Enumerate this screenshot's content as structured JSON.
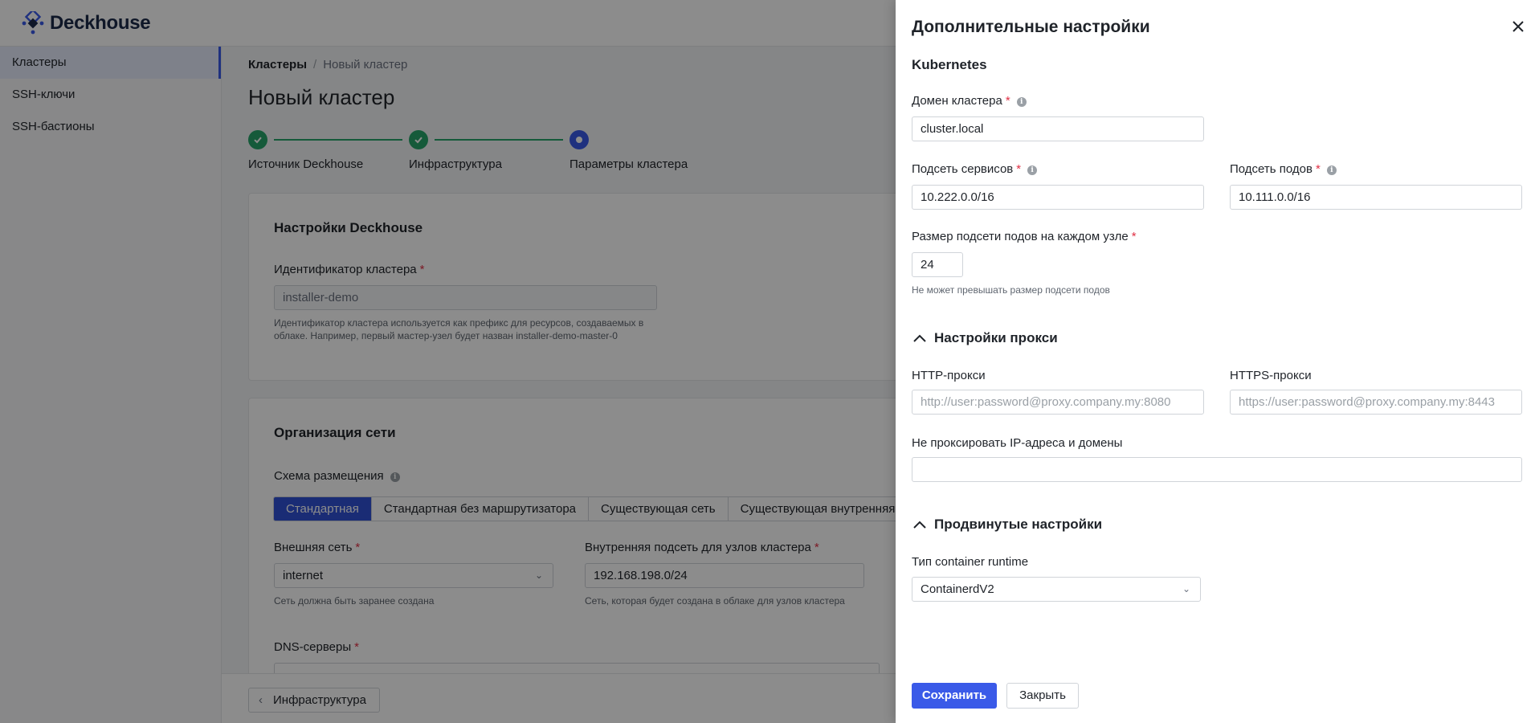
{
  "app": {
    "logo_text": "Deckhouse"
  },
  "sidebar": {
    "items": [
      {
        "label": "Кластеры",
        "active": true
      },
      {
        "label": "SSH-ключи",
        "active": false
      },
      {
        "label": "SSH-бастионы",
        "active": false
      }
    ]
  },
  "breadcrumb": {
    "root": "Кластеры",
    "separator": "/",
    "current": "Новый кластер"
  },
  "page": {
    "title": "Новый кластер"
  },
  "stepper": {
    "steps": [
      {
        "label": "Источник Deckhouse",
        "state": "done"
      },
      {
        "label": "Инфраструктура",
        "state": "done"
      },
      {
        "label": "Параметры кластера",
        "state": "current"
      }
    ]
  },
  "deckhouse_card": {
    "title": "Настройки Deckhouse",
    "cluster_id_label": "Идентификатор кластера",
    "cluster_id_value": "installer-demo",
    "cluster_id_hint": "Идентификатор кластера используется как префикс для ресурсов, создаваемых в облаке. Например, первый мастер-узел будет назван installer-demo-master-0"
  },
  "network_card": {
    "title": "Организация сети",
    "scheme_label": "Схема размещения",
    "scheme_options": [
      "Стандартная",
      "Стандартная без маршрутизатора",
      "Существующая сеть",
      "Существующая внутренняя с"
    ],
    "scheme_selected": "Стандартная",
    "external_net_label": "Внешняя сеть",
    "external_net_value": "internet",
    "external_net_hint": "Сеть должна быть заранее создана",
    "internal_subnet_label": "Внутренняя подсеть для узлов кластера",
    "internal_subnet_value": "192.168.198.0/24",
    "internal_subnet_hint": "Сеть, которая будет создана в облаке для узлов кластера",
    "dns_label": "DNS-серверы"
  },
  "footer": {
    "back_label": "Инфраструктура"
  },
  "drawer": {
    "title": "Дополнительные настройки",
    "kubernetes_title": "Kubernetes",
    "cluster_domain_label": "Домен кластера",
    "cluster_domain_value": "cluster.local",
    "service_subnet_label": "Подсеть сервисов",
    "service_subnet_value": "10.222.0.0/16",
    "pod_subnet_label": "Подсеть подов",
    "pod_subnet_value": "10.111.0.0/16",
    "node_pod_size_label": "Размер подсети подов на каждом узле",
    "node_pod_size_value": "24",
    "node_pod_size_hint": "Не может превышать размер подсети подов",
    "proxy_title": "Настройки прокси",
    "http_proxy_label": "HTTP-прокси",
    "http_proxy_placeholder": "http://user:password@proxy.company.my:8080",
    "https_proxy_label": "HTTPS-прокси",
    "https_proxy_placeholder": "https://user:password@proxy.company.my:8443",
    "no_proxy_label": "Не проксировать IP-адреса и домены",
    "no_proxy_value": "",
    "advanced_title": "Продвинутые настройки",
    "runtime_label": "Тип container runtime",
    "runtime_value": "ContainerdV2",
    "save_label": "Сохранить",
    "close_label": "Закрыть"
  },
  "colors": {
    "primary": "#3a5ae8",
    "success": "#27a56a",
    "required": "#e02f44",
    "overlay": "rgba(0,0,0,0.45)"
  }
}
